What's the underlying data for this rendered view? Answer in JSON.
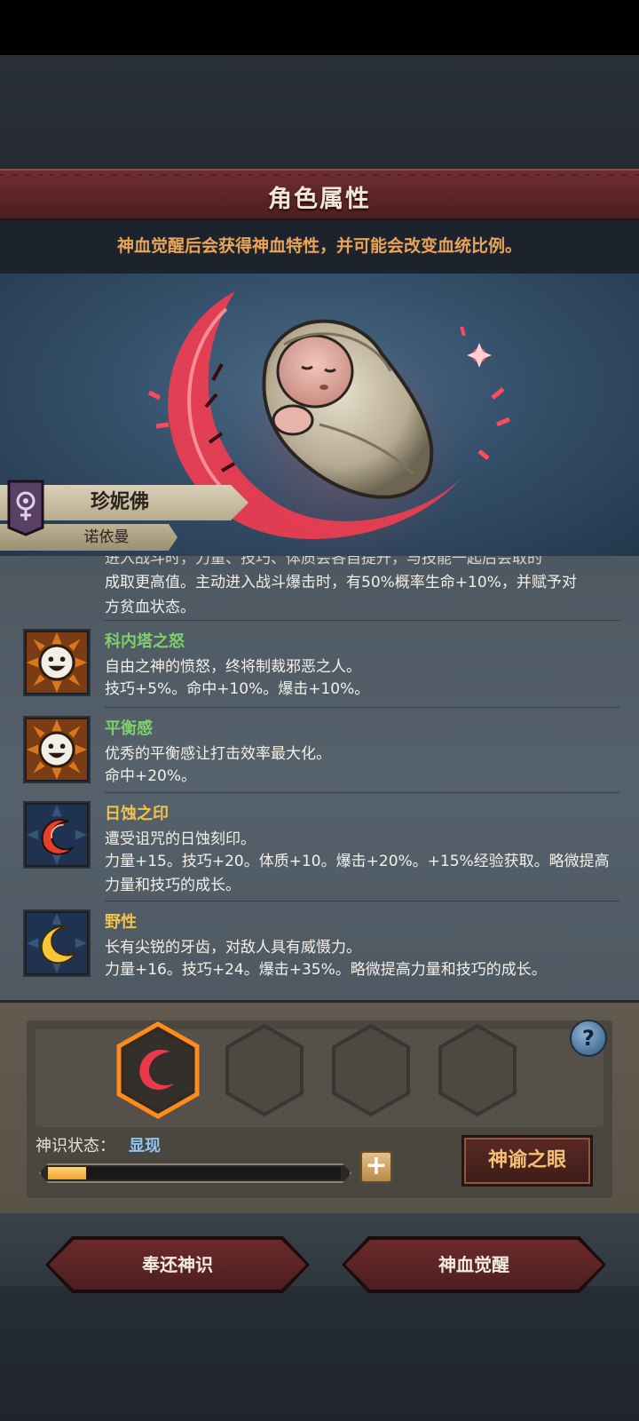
{
  "header": {
    "title": "角色属性",
    "subtitle": "神血觉醒后会获得神血特性，并可能会改变血统比例。"
  },
  "character": {
    "name": "珍妮佛",
    "origin": "诺依曼"
  },
  "traits": {
    "lead_cut_line": "进入战斗时，力量、技巧、体质会各自提升，与技能一起后会取的",
    "lead_lines": [
      "成取更高值。主动进入战斗爆击时，有50%概率生命+10%，并赋予对",
      "方贫血状态。"
    ],
    "items": [
      {
        "name": "科内塔之怒",
        "name_color": "#7fd06a",
        "icon": "smiling-sun-icon",
        "desc": "自由之神的愤怒，终将制裁邪恶之人。",
        "stats": "技巧+5%。命中+10%。爆击+10%。"
      },
      {
        "name": "平衡感",
        "name_color": "#7fd06a",
        "icon": "smiling-sun-icon",
        "desc": "优秀的平衡感让打击效率最大化。",
        "stats": "命中+20%。"
      },
      {
        "name": "日蚀之印",
        "name_color": "#f2c24a",
        "icon": "red-eclipse-icon",
        "desc": "遭受诅咒的日蚀刻印。",
        "stats": "力量+15。技巧+20。体质+10。爆击+20%。+15%经验获取。略微提高力量和技巧的成长。"
      },
      {
        "name": "野性",
        "name_color": "#f2c24a",
        "icon": "golden-crescent-icon",
        "desc": "长有尖锐的牙齿，对敌人具有威慑力。",
        "stats": "力量+16。技巧+24。爆击+35%。略微提高力量和技巧的成长。"
      }
    ]
  },
  "divine_sense": {
    "help": "?",
    "status_label": "神识状态：",
    "status_value": "显现",
    "progress_fraction": 0.13,
    "plus": "+",
    "oracle_button": "神谕之眼"
  },
  "actions": {
    "return_label": "奉还神识",
    "awaken_label": "神血觉醒"
  },
  "colors": {
    "accent_orange": "#e9a457",
    "title_red": "#5a2426",
    "status_blue": "#8ec6f2"
  }
}
